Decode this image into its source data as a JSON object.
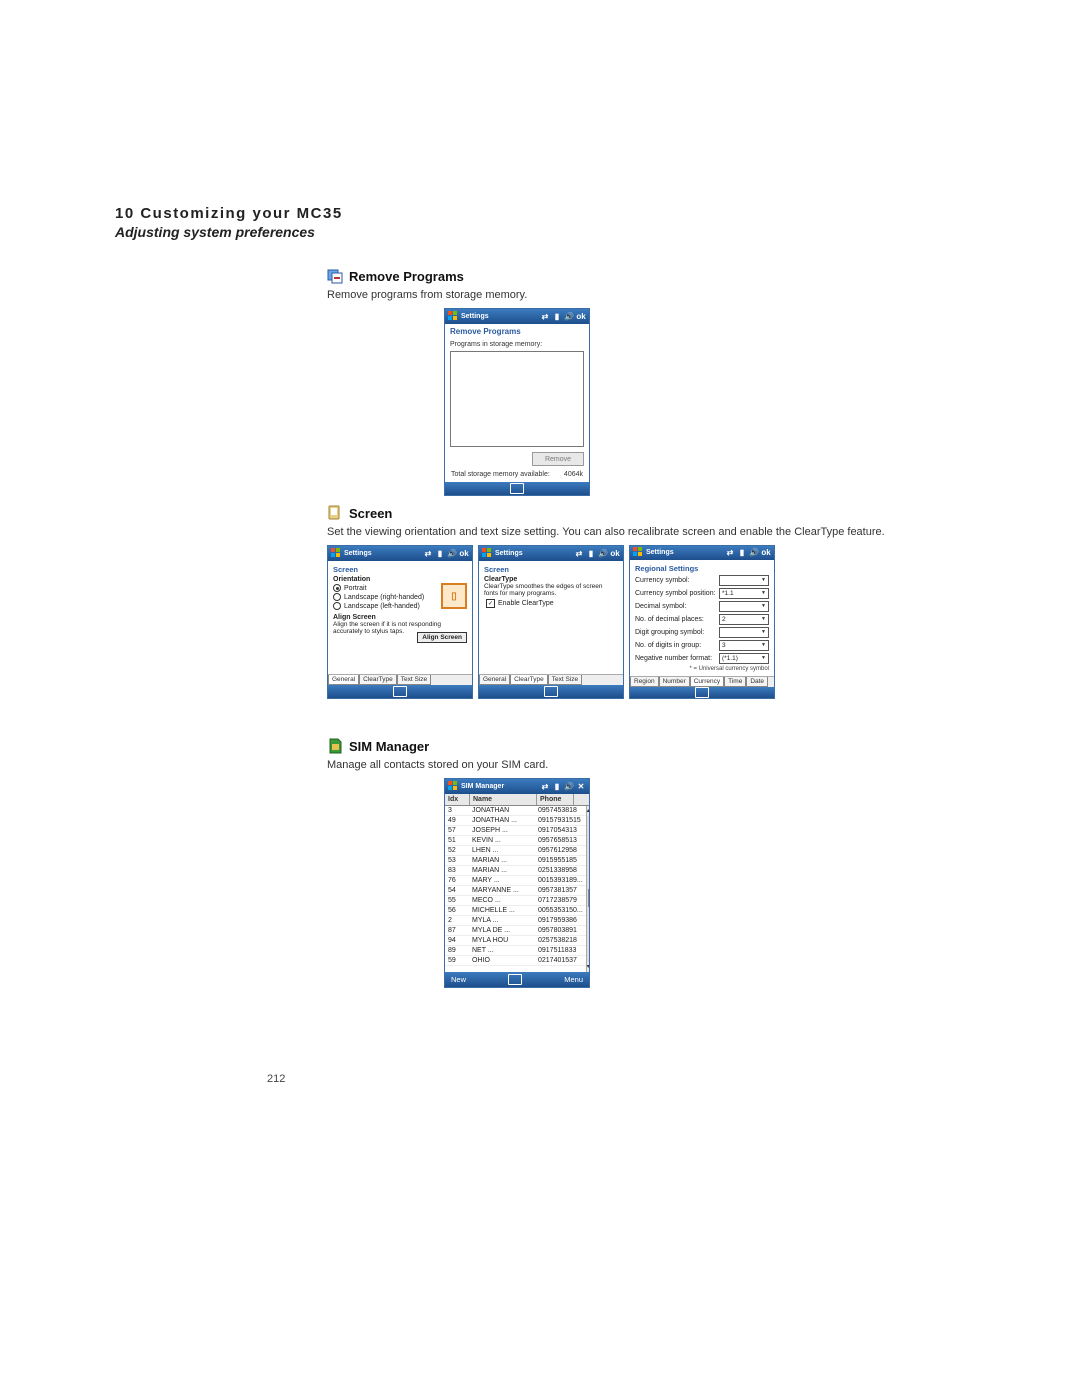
{
  "header": {
    "chapter": "10 Customizing your MC35",
    "subtitle": "Adjusting system preferences"
  },
  "remove_programs": {
    "title": "Remove Programs",
    "desc": "Remove programs from storage memory.",
    "window_title": "Settings",
    "panel_title": "Remove Programs",
    "label": "Programs in storage memory:",
    "remove_btn": "Remove",
    "total_label": "Total storage memory available:",
    "total_value": "4064k"
  },
  "screen_section": {
    "title": "Screen",
    "desc": "Set the viewing orientation and text size setting. You can also recalibrate screen and enable the ClearType feature.",
    "screens": {
      "general": {
        "window_title": "Settings",
        "sub": "Screen",
        "orientation_title": "Orientation",
        "opt1": "Portrait",
        "opt2": "Landscape (right-handed)",
        "opt3": "Landscape (left-handed)",
        "align_title": "Align Screen",
        "align_desc": "Align the screen if it is not responding accurately to stylus taps.",
        "align_btn": "Align Screen",
        "tabs": [
          "General",
          "ClearType",
          "Text Size"
        ]
      },
      "cleartype": {
        "window_title": "Settings",
        "sub": "Screen",
        "ct_title": "ClearType",
        "ct_desc": "ClearType smoothes the edges of screen fonts for many programs.",
        "ct_check": "Enable ClearType",
        "tabs": [
          "General",
          "ClearType",
          "Text Size"
        ]
      },
      "regional": {
        "window_title": "Settings",
        "sub": "Regional Settings",
        "f1": "Currency symbol:",
        "f1v": "",
        "f2": "Currency symbol position:",
        "f2v": "*1.1",
        "f3": "Decimal symbol:",
        "f3v": "",
        "f4": "No. of decimal places:",
        "f4v": "2",
        "f5": "Digit grouping symbol:",
        "f5v": "",
        "f6": "No. of digits in group:",
        "f6v": "3",
        "f7": "Negative number format:",
        "f7v": "(*1.1)",
        "note": "* = Universal currency symbol",
        "tabs": [
          "Region",
          "Number",
          "Currency",
          "Time",
          "Date"
        ]
      }
    }
  },
  "sim_section": {
    "title": "SIM Manager",
    "desc": "Manage all contacts stored on your SIM card.",
    "window_title": "SIM Manager",
    "col_idx": "Idx",
    "col_name": "Name",
    "col_phone": "Phone",
    "new_btn": "New",
    "menu_btn": "Menu",
    "rows": [
      {
        "idx": "3",
        "name": "JONATHAN",
        "phone": "0957453818"
      },
      {
        "idx": "49",
        "name": "JONATHAN ...",
        "phone": "09157931515"
      },
      {
        "idx": "57",
        "name": "JOSEPH    ...",
        "phone": "0917054313"
      },
      {
        "idx": "51",
        "name": "KEVIN     ...",
        "phone": "0957658513"
      },
      {
        "idx": "52",
        "name": "LHEN      ...",
        "phone": "0957612958"
      },
      {
        "idx": "53",
        "name": "MARIAN    ...",
        "phone": "0915955185"
      },
      {
        "idx": "83",
        "name": "MARIAN    ...",
        "phone": "0251338958"
      },
      {
        "idx": "76",
        "name": "MARY      ...",
        "phone": "0015393189..."
      },
      {
        "idx": "54",
        "name": "MARYANNE ...",
        "phone": "0957381357"
      },
      {
        "idx": "55",
        "name": "MECO      ...",
        "phone": "0717238579"
      },
      {
        "idx": "56",
        "name": "MICHELLE  ...",
        "phone": "0055353150..."
      },
      {
        "idx": "2",
        "name": "MYLA      ...",
        "phone": "0917959386"
      },
      {
        "idx": "87",
        "name": "MYLA DE   ...",
        "phone": "0957803891"
      },
      {
        "idx": "94",
        "name": "Myla hou",
        "phone": "0257538218"
      },
      {
        "idx": "89",
        "name": "NET       ...",
        "phone": "0917511833"
      },
      {
        "idx": "59",
        "name": "OHIO",
        "phone": "0217401537"
      }
    ]
  },
  "page_number": "212"
}
